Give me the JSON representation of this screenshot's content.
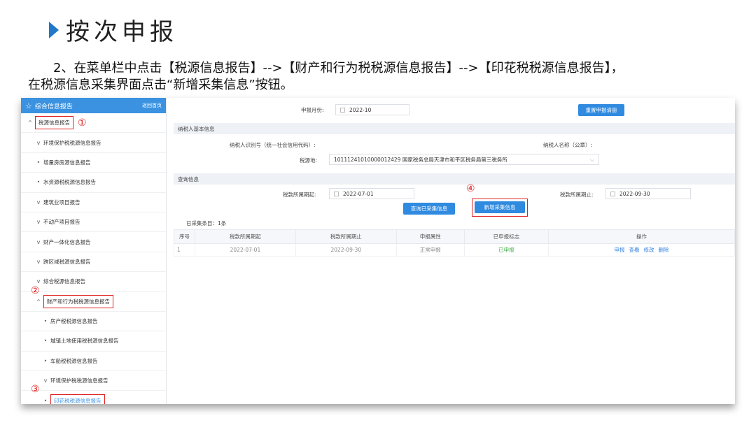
{
  "slide": {
    "title": "按次申报",
    "instruction_line1": "2、在菜单栏中点击【税源信息报告】-->【财产和行为税税源信息报告】-->【印花税税源信息报告】，",
    "instruction_line2": "在税源信息采集界面点击“新增采集信息”按钮。"
  },
  "sidebar": {
    "header_title": "综合信息报告",
    "back_label": "返回首页",
    "items": [
      {
        "marker": "^",
        "label": "税源信息报告",
        "level": 0,
        "boxed": true,
        "circle": "①"
      },
      {
        "marker": "v",
        "label": "环境保护税税源信息报告",
        "level": 1
      },
      {
        "marker": "•",
        "label": "增量房房源信息报告",
        "level": 1
      },
      {
        "marker": "•",
        "label": "水资源税税源信息报告",
        "level": 1
      },
      {
        "marker": "v",
        "label": "建筑业项目报告",
        "level": 1
      },
      {
        "marker": "v",
        "label": "不动产项目报告",
        "level": 1
      },
      {
        "marker": "v",
        "label": "财产一体化信息报告",
        "level": 1
      },
      {
        "marker": "v",
        "label": "跨区域税源信息报告",
        "level": 1
      },
      {
        "marker": "v",
        "label": "综合税源信息报告",
        "level": 1
      },
      {
        "marker": "^",
        "label": "财产和行为税税源信息报告",
        "level": 1,
        "boxed": true,
        "circle": "②"
      },
      {
        "marker": "•",
        "label": "房产税税源信息报告",
        "level": 2
      },
      {
        "marker": "•",
        "label": "城镇土地使用税税源信息报告",
        "level": 2
      },
      {
        "marker": "•",
        "label": "车船税税源信息报告",
        "level": 2
      },
      {
        "marker": "v",
        "label": "环境保护税税源信息报告",
        "level": 2
      },
      {
        "marker": "•",
        "label": "印花税税源信息报告",
        "level": 2,
        "boxed": true,
        "circle": "③",
        "active": true
      }
    ]
  },
  "form": {
    "period_label": "申报月份:",
    "period_value": "2022-10",
    "reset_button": "重置申报清册",
    "basic_section": "纳税人基本信息",
    "taxpayer_id_label": "纳税人识别号（统一社会信用代码）:",
    "taxpayer_name_label": "纳税人名称（公章）:",
    "tax_office_label": "税源地:",
    "tax_office_value": "10111241010000012429 国家税务总局天津市和平区税务局第三税务所",
    "query_section": "查询信息",
    "start_label": "税款所属期起:",
    "start_value": "2022-07-01",
    "end_label": "税款所属期止:",
    "end_value": "2022-09-30",
    "query_button": "查询已采集信息",
    "add_button": "新增采集信息",
    "add_circle": "④",
    "count_text": "已采集条目：1条"
  },
  "table": {
    "headers": [
      "序号",
      "税款所属期起",
      "税款所属期止",
      "申报属性",
      "已申报标志",
      "操作"
    ],
    "rows": [
      {
        "no": "1",
        "start": "2022-07-01",
        "end": "2022-09-30",
        "attr": "正常申报",
        "flag": "已申报",
        "ops": [
          "申报",
          "查看",
          "修改",
          "删除"
        ]
      }
    ]
  },
  "colors": {
    "accent": "#2f8ae0",
    "highlight": "#e02020",
    "success": "#43b047"
  }
}
